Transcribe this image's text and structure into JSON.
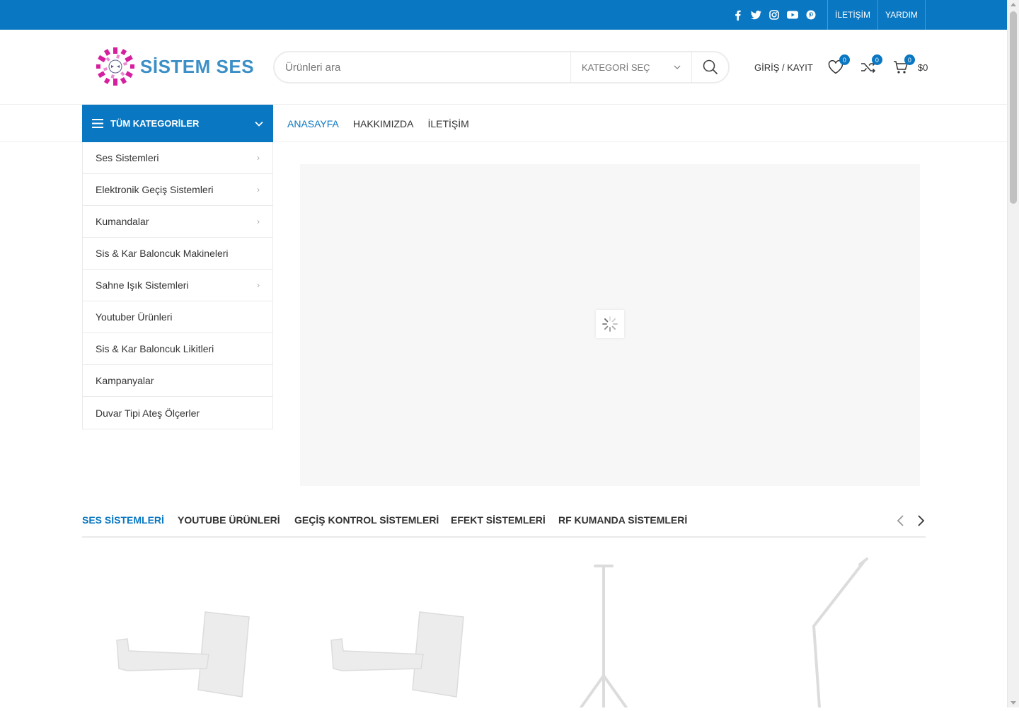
{
  "topbar": {
    "social_icons": [
      "facebook-icon",
      "twitter-icon",
      "instagram-icon",
      "youtube-icon",
      "pinterest-icon"
    ],
    "links": [
      "İLETİŞİM",
      "YARDIM"
    ],
    "bg_color": "#0a77c2"
  },
  "header": {
    "logo_text": "SİSTEM SES",
    "search_placeholder": "Ürünleri ara",
    "category_select": "KATEGORİ SEÇ",
    "login_label": "GİRİŞ / KAYIT",
    "wishlist_count": "0",
    "compare_count": "0",
    "cart_count": "0",
    "cart_total": "$0"
  },
  "nav": {
    "all_categories": "TÜM KATEGORİLER",
    "items": [
      "ANASAYFA",
      "HAKKIMIZDA",
      "İLETİŞİM"
    ]
  },
  "categories": [
    {
      "label": "Ses Sistemleri",
      "has_sub": true
    },
    {
      "label": "Elektronik Geçiş Sistemleri",
      "has_sub": true
    },
    {
      "label": "Kumandalar",
      "has_sub": true
    },
    {
      "label": "Sis & Kar Baloncuk Makineleri",
      "has_sub": false
    },
    {
      "label": "Sahne Işık Sistemleri",
      "has_sub": true
    },
    {
      "label": "Youtuber Ürünleri",
      "has_sub": false
    },
    {
      "label": "Sis & Kar Baloncuk Likitleri",
      "has_sub": false
    },
    {
      "label": "Kampanyalar",
      "has_sub": false
    },
    {
      "label": "Duvar Tipi Ateş Ölçerler",
      "has_sub": false
    }
  ],
  "product_tabs": [
    "SES SİSTEMLERİ",
    "YOUTUBE ÜRÜNLERİ",
    "GEÇİŞ KONTROL SİSTEMLERİ",
    "EFEKT SİSTEMLERİ",
    "RF KUMANDA SİSTEMLERİ"
  ],
  "products": [
    "speaker-wall-bracket-image",
    "speaker-wall-bracket-image",
    "tripod-speaker-stand-image",
    "boom-microphone-stand-image"
  ]
}
